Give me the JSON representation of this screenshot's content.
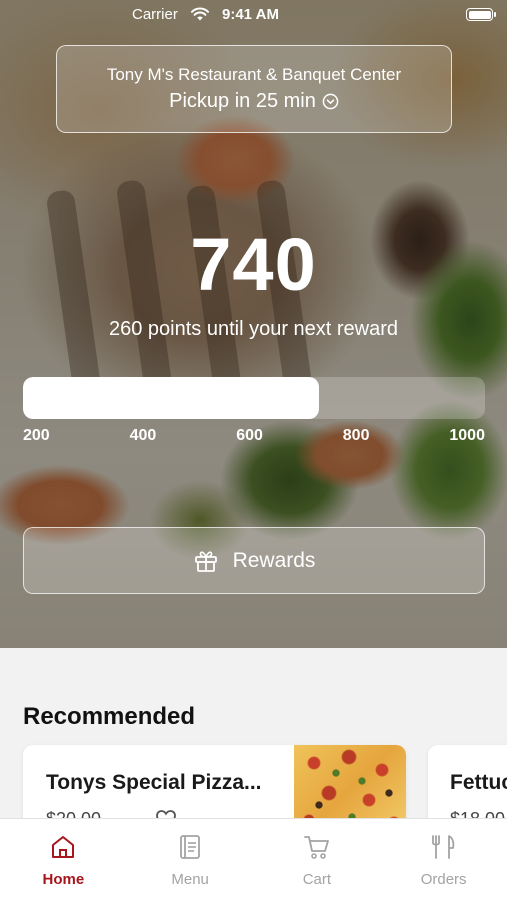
{
  "status_bar": {
    "carrier": "Carrier",
    "time": "9:41 AM"
  },
  "restaurant": {
    "name": "Tony M's Restaurant & Banquet Center",
    "pickup_label": "Pickup in 25 min"
  },
  "rewards": {
    "points": "740",
    "caption": "260 points until your next reward",
    "progress_fraction": 0.64,
    "scale_labels": [
      "200",
      "400",
      "600",
      "800",
      "1000"
    ],
    "button_label": "Rewards"
  },
  "recommended": {
    "title": "Recommended",
    "items": [
      {
        "name": "Tonys Special Pizza...",
        "price": "$20.00"
      },
      {
        "name": "Fettuc",
        "price": "$18.00"
      }
    ]
  },
  "tabs": [
    {
      "label": "Home",
      "icon": "home-icon",
      "active": true
    },
    {
      "label": "Menu",
      "icon": "menu-icon",
      "active": false
    },
    {
      "label": "Cart",
      "icon": "cart-icon",
      "active": false
    },
    {
      "label": "Orders",
      "icon": "orders-icon",
      "active": false
    }
  ],
  "colors": {
    "accent": "#a5161d",
    "inactive_tab": "#a3a3a3"
  }
}
